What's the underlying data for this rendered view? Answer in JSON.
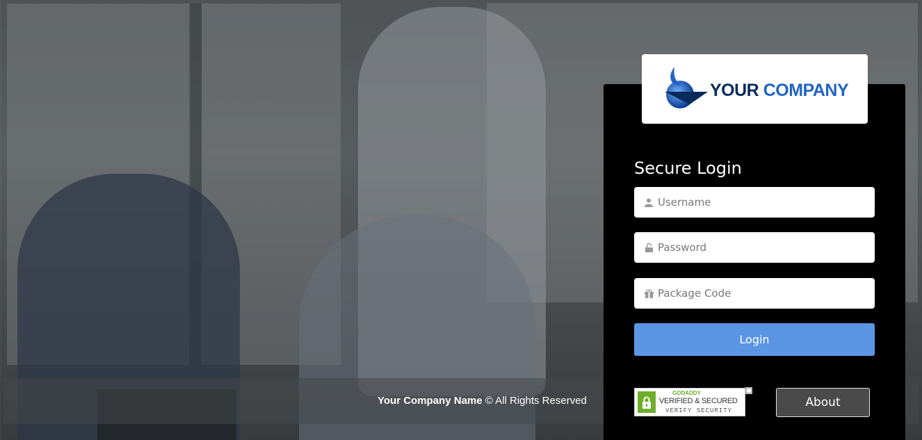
{
  "logo": {
    "word1": "YOUR",
    "word2": "COMPANY"
  },
  "login": {
    "title": "Secure Login",
    "username_placeholder": "Username",
    "password_placeholder": "Password",
    "package_placeholder": "Package Code",
    "button_label": "Login"
  },
  "footer": {
    "company_name": "Your Company Name",
    "rights": "© All Rights Reserved"
  },
  "seal": {
    "line1": "GODADDY",
    "line2": "VERIFIED & SECURED",
    "line3": "VERIFY SECURITY"
  },
  "about_label": "About",
  "icons": {
    "username": "user-icon",
    "password": "lock-icon",
    "package": "gift-icon",
    "seal": "padlock-icon"
  },
  "colors": {
    "panel": "#000000",
    "login_button": "#5b95e3",
    "about_button": "#4a4a4a",
    "logo_dark": "#0a2a5c",
    "logo_blue": "#1f63c6",
    "seal_green": "#6fae2a"
  }
}
